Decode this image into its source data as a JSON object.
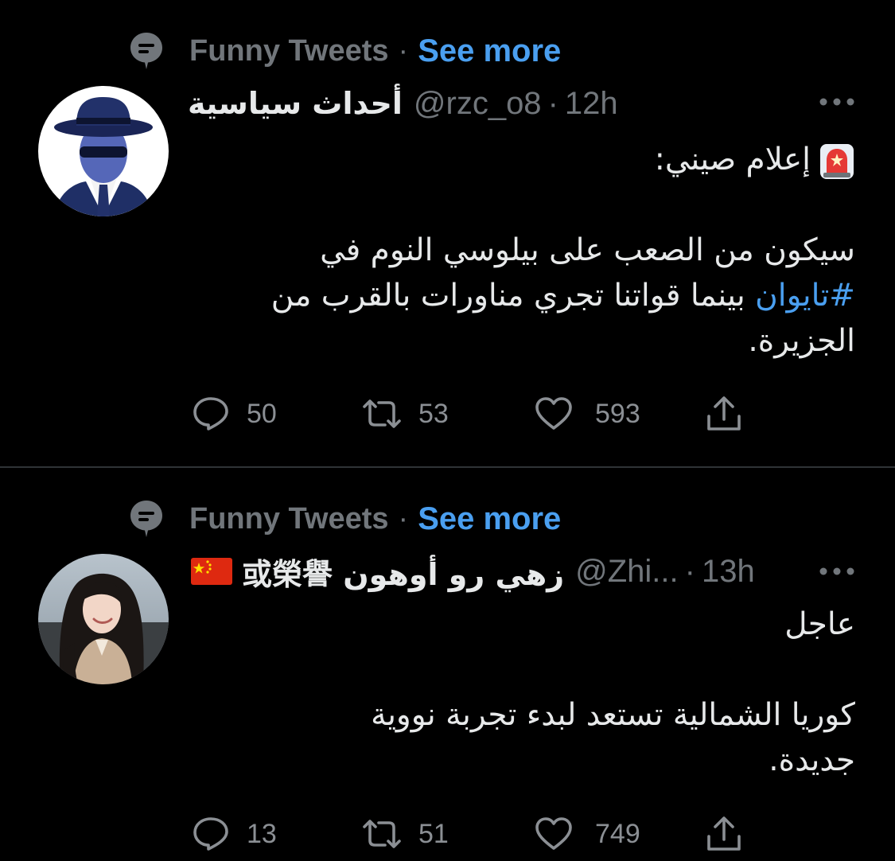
{
  "tweets": [
    {
      "context": {
        "label": "Funny Tweets",
        "separator": "·",
        "link": "See more"
      },
      "author": {
        "display_name": "أحداث سياسية",
        "handle": "@rzc_o8",
        "time": "12h"
      },
      "body": {
        "line1": "إعلام صيني:",
        "line2": "سيكون من الصعب على بيلوسي النوم في",
        "line3_hashtag": "#تايوان",
        "line3_rest": " بينما قواتنا تجري مناورات بالقرب من",
        "line4": "الجزيرة."
      },
      "stats": {
        "replies": "50",
        "retweets": "53",
        "likes": "593"
      },
      "avatar_icon": "spy-avatar",
      "emoji_icon": "siren-icon"
    },
    {
      "context": {
        "label": "Funny Tweets",
        "separator": "·",
        "link": "See more"
      },
      "author": {
        "display_name": "زهي رو أوهون 或榮譽",
        "handle": "@Zhi...",
        "time": "13h",
        "flag": "china-flag"
      },
      "body": {
        "line1": "عاجل",
        "line2": "كوريا الشمالية تستعد لبدء تجربة نووية",
        "line3": "جديدة."
      },
      "stats": {
        "replies": "13",
        "retweets": "51",
        "likes": "749"
      },
      "avatar_icon": "woman-photo-avatar"
    }
  ],
  "colors": {
    "background": "#000000",
    "text": "#e7e9ea",
    "muted": "#71767b",
    "link": "#4a9ff0",
    "divider": "#2f3336"
  }
}
